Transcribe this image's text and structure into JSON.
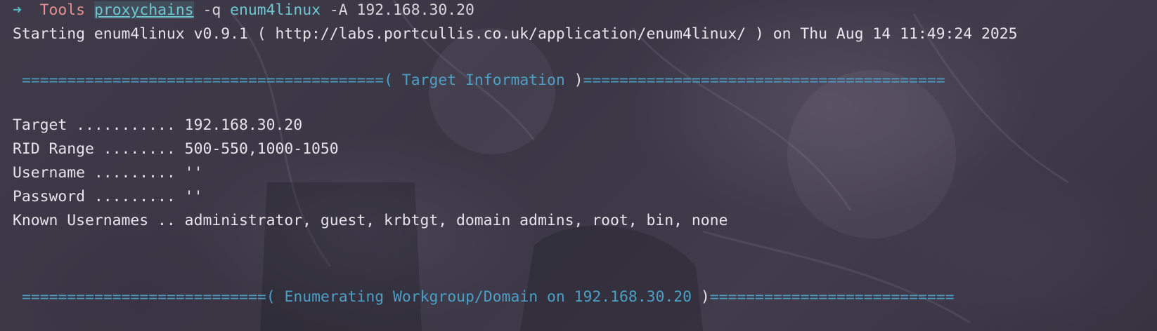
{
  "prompt": {
    "arrow": "➜",
    "directory": "Tools",
    "command": "proxychains",
    "flag": "-q",
    "tool": "enum4linux",
    "args": "-A 192.168.30.20"
  },
  "lines": {
    "starting": "Starting enum4linux v0.9.1 ( http://labs.portcullis.co.uk/application/enum4linux/ ) on Thu Aug 14 11:49:24 2025",
    "banner1_left": "========================================",
    "banner1_title": "Target Information",
    "banner1_right": "========================================",
    "target": "Target ........... 192.168.30.20",
    "rid_range": "RID Range ........ 500-550,1000-1050",
    "username": "Username ......... ''",
    "password": "Password ......... ''",
    "known_usernames": "Known Usernames .. administrator, guest, krbtgt, domain admins, root, bin, none",
    "banner2_left": "===========================",
    "banner2_title": "Enumerating Workgroup/Domain on 192.168.30.20",
    "banner2_right": "==========================="
  },
  "colors": {
    "background": "#3a3644",
    "prompt_arrow": "#58b6c0",
    "prompt_dir": "#e88f8f",
    "command": "#6ec6d1",
    "banner": "#4b9fc4",
    "text": "#e6e3ea"
  }
}
